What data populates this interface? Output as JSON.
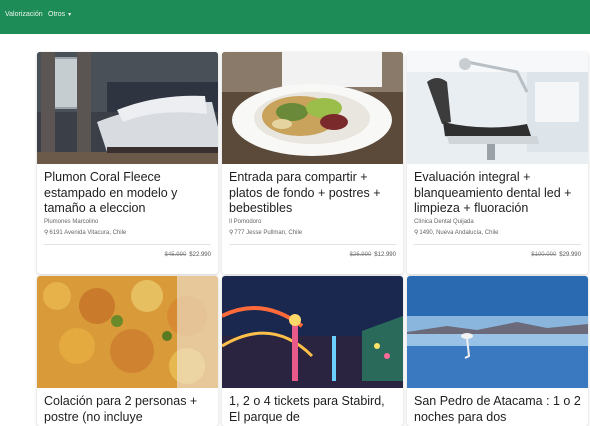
{
  "nav": {
    "items": [
      {
        "label": "Valorización"
      },
      {
        "label": "Otros",
        "icon": "caret-down-icon"
      }
    ],
    "color": "#1e8c57"
  },
  "cards": [
    {
      "title": "Plumon Coral Fleece estampado en modelo y tamaño a eleccion",
      "merchant": "Plumones Marcolino",
      "address": "6191 Avenida Vitacura, Chile",
      "old_price": "$45.990",
      "new_price": "$22.990"
    },
    {
      "title": "Entrada para compartir + platos de fondo + postres + bebestibles",
      "merchant": "Il Pomodoro",
      "address": "777 Jesse Pullman, Chile",
      "old_price": "$26.990",
      "new_price": "$12.990"
    },
    {
      "title": "Evaluación integral + blanqueamiento dental led + limpieza + fluoración",
      "merchant": "Clínica Dental Quijada",
      "address": "1490, Nueva Andalucía, Chile",
      "old_price": "$100.000",
      "new_price": "$29.990"
    },
    {
      "title": "Colación para 2 personas + postre (no incluye"
    },
    {
      "title": "1, 2 o 4 tickets para Stabird, El parque de"
    },
    {
      "title": "San Pedro de Atacama : 1 o 2 noches para dos"
    }
  ],
  "icons": {
    "pin": "map-pin-icon"
  }
}
